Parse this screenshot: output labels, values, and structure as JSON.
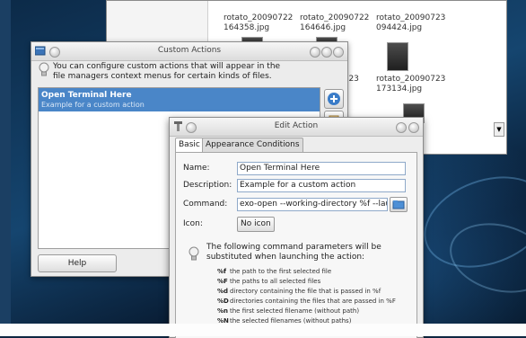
{
  "file_manager": {
    "files": [
      {
        "name_line1": "rotato_20090722",
        "name_line2": "164358.jpg"
      },
      {
        "name_line1": "rotato_20090722",
        "name_line2": "164646.jpg"
      },
      {
        "name_line1": "rotato_20090723",
        "name_line2": "094424.jpg"
      },
      {
        "name_line1": "rotato_20090723",
        "name_line2": "173134.jpg"
      }
    ],
    "partial_label": "0723"
  },
  "custom_actions": {
    "title": "Custom Actions",
    "info_line1": "You can configure custom actions that will appear in the",
    "info_line2": "file managers context menus for certain kinds of files.",
    "actions": [
      {
        "name": "Open Terminal Here",
        "description": "Example for a custom action"
      }
    ],
    "help_label": "Help"
  },
  "edit_action": {
    "title": "Edit Action",
    "tabs": [
      "Basic",
      "Appearance Conditions"
    ],
    "active_tab": "Basic",
    "name_label": "Name:",
    "name_value": "Open Terminal Here",
    "description_label": "Description:",
    "description_value": "Example for a custom action",
    "command_label": "Command:",
    "command_value": "exo-open --working-directory %f --laun",
    "icon_label": "Icon:",
    "icon_button_label": "No icon",
    "params_intro_line1": "The following command parameters will be",
    "params_intro_line2": "substituted when launching the action:",
    "parameters": [
      {
        "code": "%f",
        "text": "the path to the first selected file"
      },
      {
        "code": "%F",
        "text": "the paths to all selected files"
      },
      {
        "code": "%d",
        "text": "directory containing the file that is passed in %f"
      },
      {
        "code": "%D",
        "text": "directories containing the files that are passed in %F"
      },
      {
        "code": "%n",
        "text": "the first selected filename (without path)"
      },
      {
        "code": "%N",
        "text": "the selected filenames (without paths)"
      }
    ]
  },
  "colors": {
    "selection": "#4a86c8",
    "desktop_dark": "#0c2a48",
    "field_border": "#8fa9c9"
  }
}
